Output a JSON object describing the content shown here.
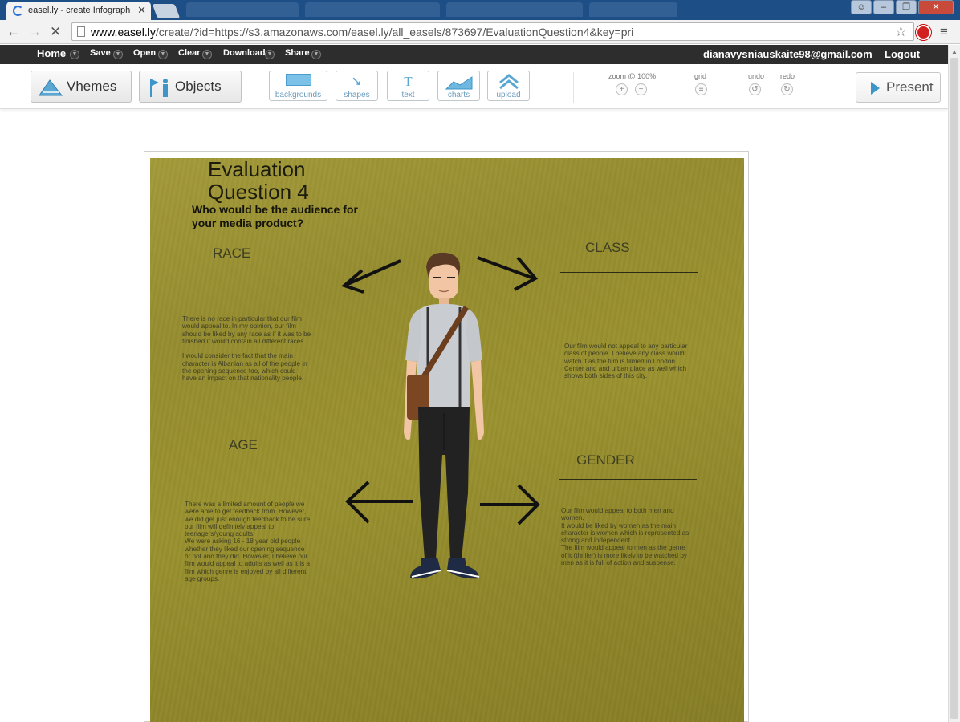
{
  "browser": {
    "tab_title": "easel.ly - create Infograph",
    "url_host": "www.easel.ly",
    "url_path": "/create/?id=https://s3.amazonaws.com/easel.ly/all_easels/873697/EvaluationQuestion4&key=pri"
  },
  "app_menu": {
    "home": "Home",
    "save": "Save",
    "open": "Open",
    "clear": "Clear",
    "download": "Download",
    "share": "Share",
    "user_email": "dianavysniauskaite98@gmail.com",
    "logout": "Logout"
  },
  "toolbar": {
    "vhemes": "Vhemes",
    "objects": "Objects",
    "backgrounds": "backgrounds",
    "shapes": "shapes",
    "text": "text",
    "charts": "charts",
    "upload": "upload",
    "zoom_label": "zoom @ 100%",
    "grid_label": "grid",
    "undo_label": "undo",
    "redo_label": "redo",
    "present": "Present"
  },
  "poster": {
    "title_line1": "Evaluation",
    "title_line2": "Question  4",
    "subtitle": "Who would be the audience for  your media product?",
    "race_heading": "RACE",
    "race_text": "There is no race in particular that our film\nwould  appeal to. In my opinion, our film\nshould  be liked by any race as if it was to be\nfinished  it would contain all different races.\n\nI would consider the fact that the main\ncharacter  is Albanian as all of the people in\nthe  opening sequence too, which could\nhave  an impact on that nationality people.",
    "class_heading": "CLASS",
    "class_text": "Our film would not appeal to any particular\nclass  of people. I believe any class would\nwatch  it as the film is filmed in London\nCenter  and and urban place as well which\nshows  both sides of this city.",
    "age_heading": "AGE",
    "age_text": "There was a limited amount of people we\nwere  able to get feedback from. However,\nwe  did get just enough feedback to be sure\nour  film will definitely appeal to\nteenagers/young  adults.\nWe were asking 16 - 18 year old people\nwhether  they liked our opening sequence\nor  not and they did. However, I believe our\nfilm  would appeal to adults as well as it is a\nfilm  which genre is enjoyed by all different\nage  groups.",
    "gender_heading": "GENDER",
    "gender_text": "Our film would appeal to both men and\nwomen.\nIt would be liked by women as the main\ncharacter  is women which is represented as\nstrong  and independent.\nThe film would appeal to men as the genre\nof  it (thriller) is more likely to be watched by\nmen  as it is full of action and suspense."
  },
  "colors": {
    "poster_bg": "#978e2f",
    "menu_bar": "#2d2d2d",
    "accent_blue": "#3d95c9"
  }
}
